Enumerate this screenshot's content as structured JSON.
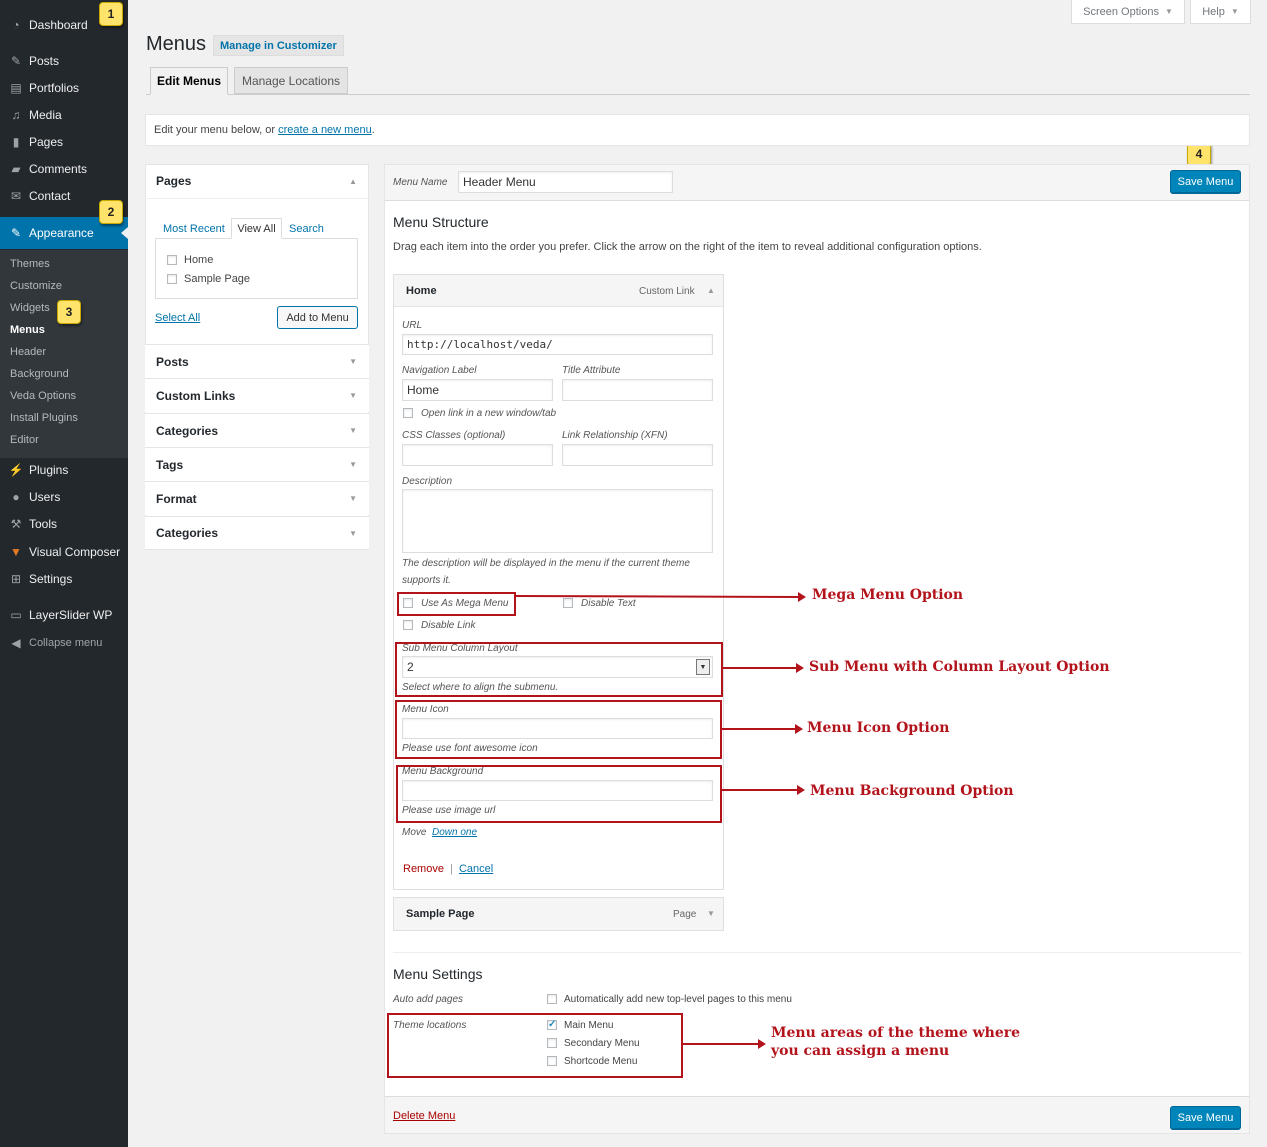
{
  "sidebar": {
    "dashboard": "Dashboard",
    "posts": "Posts",
    "portfolios": "Portfolios",
    "media": "Media",
    "pages": "Pages",
    "comments": "Comments",
    "contact": "Contact",
    "appearance": "Appearance",
    "sub": [
      "Themes",
      "Customize",
      "Widgets",
      "Menus",
      "Header",
      "Background",
      "Veda Options",
      "Install Plugins",
      "Editor"
    ],
    "plugins": "Plugins",
    "users": "Users",
    "tools": "Tools",
    "visual_composer": "Visual Composer",
    "settings": "Settings",
    "layerslider": "LayerSlider WP",
    "collapse": "Collapse menu"
  },
  "badges": [
    "1",
    "2",
    "3",
    "4"
  ],
  "top": {
    "screen_options": "Screen Options",
    "help": "Help"
  },
  "page": {
    "title": "Menus",
    "customizer_link": "Manage in Customizer",
    "tab_edit": "Edit Menus",
    "tab_locations": "Manage Locations",
    "notice_pre": "Edit your menu below, or ",
    "notice_link": "create a new menu",
    "notice_post": "."
  },
  "left": {
    "pages_title": "Pages",
    "tabs": [
      "Most Recent",
      "View All",
      "Search"
    ],
    "items": [
      "Home",
      "Sample Page"
    ],
    "select_all": "Select All",
    "add_to_menu": "Add to Menu",
    "accordions": [
      "Posts",
      "Custom Links",
      "Categories",
      "Tags",
      "Format",
      "Categories"
    ]
  },
  "menu": {
    "name_label": "Menu Name",
    "name_value": "Header Menu",
    "save": "Save Menu",
    "structure_title": "Menu Structure",
    "structure_desc": "Drag each item into the order you prefer. Click the arrow on the right of the item to reveal additional configuration options.",
    "item1_title": "Home",
    "item1_type": "Custom Link",
    "url_label": "URL",
    "url_value": "http://localhost/veda/",
    "nav_label": "Navigation Label",
    "nav_value": "Home",
    "title_attr": "Title Attribute",
    "open_new": "Open link in a new window/tab",
    "css_classes": "CSS Classes (optional)",
    "xfn": "Link Relationship (XFN)",
    "description": "Description",
    "desc_help1": "The description will be displayed in the menu if the current theme",
    "desc_help2": "supports it.",
    "mega": "Use As Mega Menu",
    "disable_text": "Disable Text",
    "disable_link": "Disable Link",
    "sub_layout_label": "Sub Menu Column Layout",
    "sub_layout_value": "2",
    "sub_layout_help": "Select where to align the submenu.",
    "icon_label": "Menu Icon",
    "icon_help": "Please use font awesome icon",
    "bg_label": "Menu Background",
    "bg_help": "Please use image url",
    "move": "Move",
    "down_one": "Down one",
    "remove": "Remove",
    "sep": "|",
    "cancel": "Cancel",
    "item2_title": "Sample Page",
    "item2_type": "Page",
    "settings_title": "Menu Settings",
    "auto_add_label": "Auto add pages",
    "auto_add_text": "Automatically add new top-level pages to this menu",
    "theme_loc_label": "Theme locations",
    "locations": [
      "Main Menu",
      "Secondary Menu",
      "Shortcode Menu"
    ],
    "delete": "Delete Menu"
  },
  "annotations": {
    "mega": "Mega Menu Option",
    "sub": "Sub Menu with Column Layout Option",
    "icon": "Menu Icon Option",
    "bg": "Menu Background Option",
    "areas1": "Menu areas of the theme where",
    "areas2": "you can assign a menu"
  },
  "colors": {
    "admin_bar": "#23282d",
    "accent": "#0073aa",
    "annotation": "#b3141c",
    "badge": "#ffe36a"
  }
}
